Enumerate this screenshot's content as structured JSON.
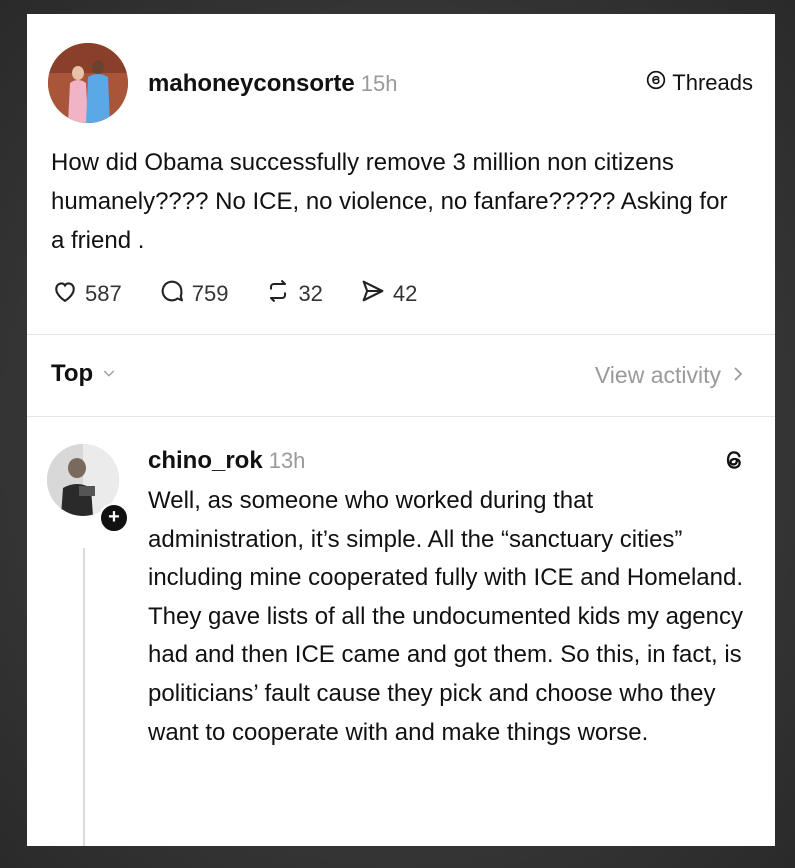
{
  "post": {
    "username": "mahoneyconsorte",
    "time": "15h",
    "badge_label": "Threads",
    "text": "How did Obama successfully remove 3 million non citizens humanely???? No ICE, no violence, no fanfare????? Asking for a friend .",
    "likes": "587",
    "replies": "759",
    "reposts": "32",
    "shares": "42"
  },
  "sort": {
    "label": "Top"
  },
  "activity": {
    "label": "View activity"
  },
  "reply": {
    "username": "chino_rok",
    "time": "13h",
    "text": "Well, as someone who worked during that administration, it’s simple. All the “sanctuary cities” including mine cooperated fully with ICE and Homeland. They gave lists of all the undocumented kids my agency had and then ICE came and got them. So this, in fact, is politicians’ fault cause they pick and choose who they want to cooperate with and make things worse."
  },
  "icons": {
    "like": "heart-icon",
    "reply": "comment-icon",
    "repost": "repost-icon",
    "share": "send-icon",
    "threads": "threads-logo-icon",
    "follow": "plus-icon"
  },
  "colors": {
    "text": "#111111",
    "muted": "#9a9a9a",
    "background": "#ffffff"
  }
}
